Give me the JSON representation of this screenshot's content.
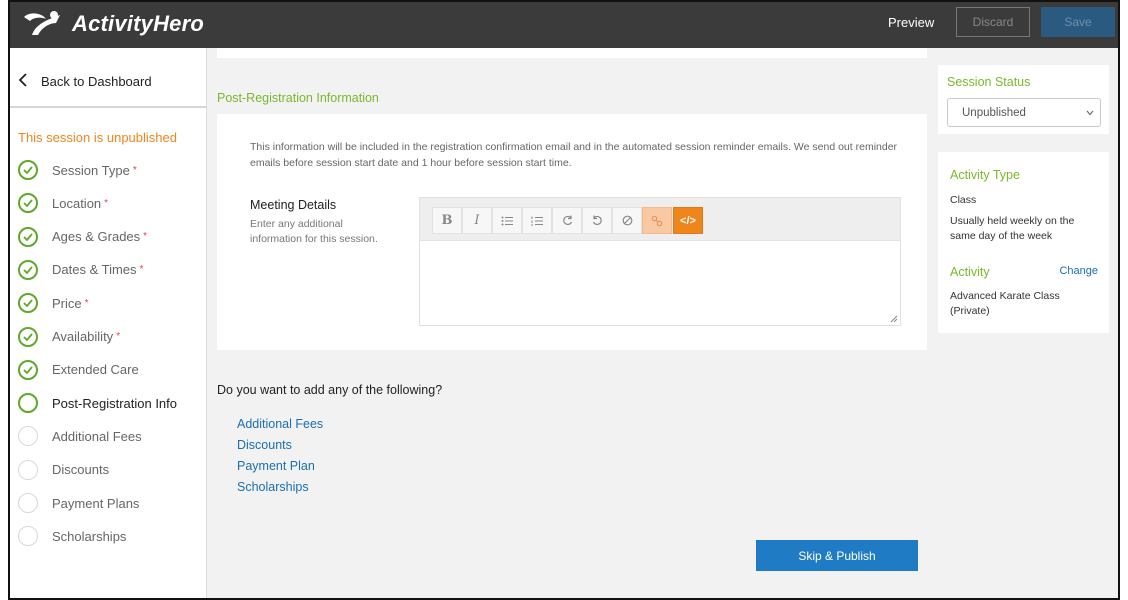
{
  "header": {
    "logo_text": "ActivityHero",
    "preview_label": "Preview",
    "discard_label": "Discard",
    "save_label": "Save"
  },
  "sidebar": {
    "back_label": "Back to Dashboard",
    "unpublished_note": "This session is unpublished",
    "required_marker": "*",
    "steps": [
      {
        "label": "Session Type",
        "required": true,
        "state": "done"
      },
      {
        "label": "Location",
        "required": true,
        "state": "done"
      },
      {
        "label": "Ages & Grades",
        "required": true,
        "state": "done"
      },
      {
        "label": "Dates & Times",
        "required": true,
        "state": "done"
      },
      {
        "label": "Price",
        "required": true,
        "state": "done"
      },
      {
        "label": "Availability",
        "required": true,
        "state": "done"
      },
      {
        "label": "Extended Care",
        "required": false,
        "state": "done"
      },
      {
        "label": "Post-Registration Info",
        "required": false,
        "state": "current"
      },
      {
        "label": "Additional Fees",
        "required": false,
        "state": "todo"
      },
      {
        "label": "Discounts",
        "required": false,
        "state": "todo"
      },
      {
        "label": "Payment Plans",
        "required": false,
        "state": "todo"
      },
      {
        "label": "Scholarships",
        "required": false,
        "state": "todo"
      }
    ]
  },
  "main": {
    "section_title": "Post-Registration Information",
    "description": "This information will be included in the registration confirmation email and in the automated session reminder emails. We send out reminder emails before session start date and 1 hour before session start time.",
    "meeting_details_title": "Meeting Details",
    "meeting_details_help": "Enter any additional information for this session.",
    "editor_value": "",
    "toolbar_icons": [
      "bold-icon",
      "italic-icon",
      "bulleted-list-icon",
      "numbered-list-icon",
      "redo-icon",
      "undo-icon",
      "clear-format-icon",
      "link-icon",
      "code-view-icon"
    ],
    "toolbar_glyphs": {
      "bold": "B",
      "italic": "I",
      "code": "</>"
    },
    "add_question": "Do you want to add any of the following?",
    "add_links": [
      "Additional Fees",
      "Discounts",
      "Payment Plan",
      "Scholarships"
    ],
    "publish_label": "Skip & Publish"
  },
  "right": {
    "status_title": "Session Status",
    "status_value": "Unpublished",
    "activity_type_title": "Activity Type",
    "activity_type_value": "Class",
    "activity_type_desc": "Usually held weekly on the same day of the week",
    "activity_title": "Activity",
    "change_label": "Change",
    "activity_value": "Advanced Karate Class (Private)"
  },
  "colors": {
    "accent_green": "#7ab82e",
    "accent_orange": "#f0851b",
    "link_blue": "#1a6fb0",
    "primary_button": "#1e7bc4",
    "topbar": "#3b3b3b"
  }
}
